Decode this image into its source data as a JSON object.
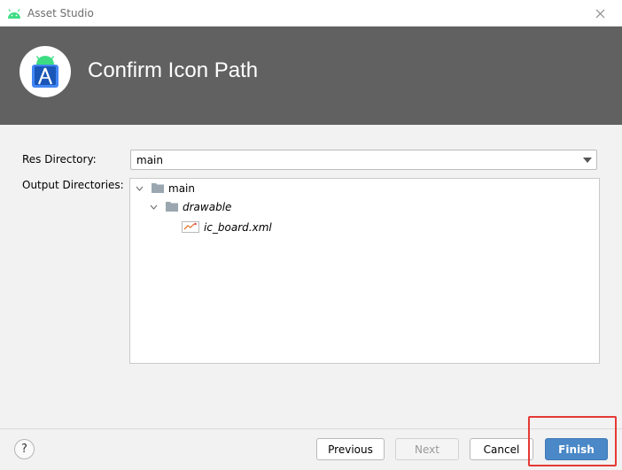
{
  "window": {
    "title": "Asset Studio",
    "app_icon": "android-icon",
    "close_icon": "close-icon"
  },
  "banner": {
    "heading": "Confirm Icon Path",
    "logo_icon": "android-studio-logo-icon",
    "background": "#616161"
  },
  "form": {
    "res_directory_label": "Res Directory:",
    "res_directory_value": "main",
    "output_directories_label": "Output Directories:"
  },
  "tree": {
    "nodes": [
      {
        "label": "main",
        "type": "folder",
        "expanded": true
      },
      {
        "label": "drawable",
        "type": "folder",
        "expanded": true
      },
      {
        "label": "ic_board.xml",
        "type": "file"
      }
    ]
  },
  "footer": {
    "help_label": "?",
    "previous_label": "Previous",
    "next_label": "Next",
    "cancel_label": "Cancel",
    "finish_label": "Finish"
  },
  "colors": {
    "accent": "#4a88c7",
    "highlight": "#e53935"
  }
}
